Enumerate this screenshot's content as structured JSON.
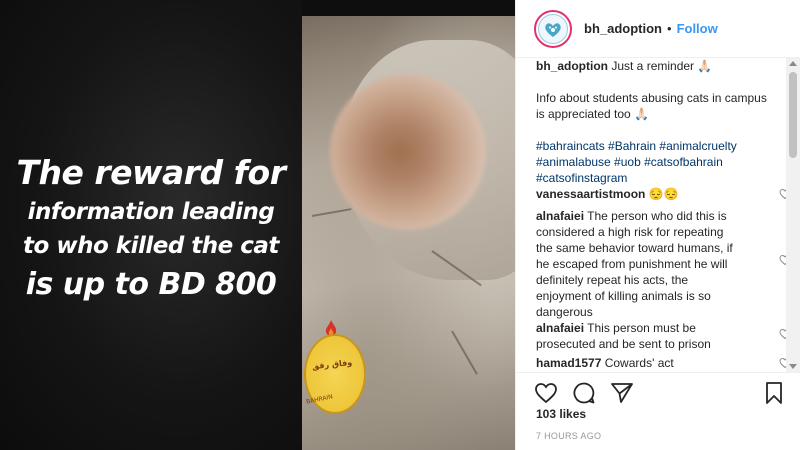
{
  "post": {
    "username": "bh_adoption",
    "follow_label": "Follow",
    "separator": "•",
    "likes": "103 likes",
    "timestamp": "7 HOURS AGO"
  },
  "media": {
    "overlay_lines": [
      "The reward for",
      "information leading",
      "to who killed the cat",
      "is up to BD 800"
    ],
    "stamp_text": "وفاق رفق",
    "stamp_text2": "BAHRAIN"
  },
  "caption": {
    "username": "bh_adoption",
    "line1": "Just a reminder 🙏🏻",
    "line2": "Info about students abusing cats in campus",
    "line3": "is appreciated too 🙏🏻",
    "hashtags_line1": "#bahraincats #Bahrain #animalcruelty",
    "hashtags_line2": "#animalabuse #uob #catsofbahrain",
    "hashtags_line3": "#catsofinstagram"
  },
  "comments": [
    {
      "username": "vanessaartistmoon",
      "lines": [
        "😔😔"
      ]
    },
    {
      "username": "alnafaiei",
      "lines": [
        "The person who did this is",
        "considered a high risk for repeating",
        "the same behavior toward humans, if",
        "he escaped from punishment he will",
        "definitely repeat his acts, the",
        "enjoyment of killing animals is so",
        "dangerous"
      ]
    },
    {
      "username": "alnafaiei",
      "lines": [
        "This person must be",
        "prosecuted and be sent to prison"
      ]
    },
    {
      "username": "hamad1577",
      "lines": [
        "Cowards' act"
      ]
    }
  ],
  "icons": {
    "like": "heart-icon",
    "comment": "comment-icon",
    "share": "share-icon",
    "save": "bookmark-icon",
    "comment_like": "heart-icon"
  },
  "colors": {
    "link": "#3897f0",
    "hashtag": "#003569",
    "text": "#262626",
    "muted": "#999999",
    "avatar_ring": "#e1306c"
  }
}
